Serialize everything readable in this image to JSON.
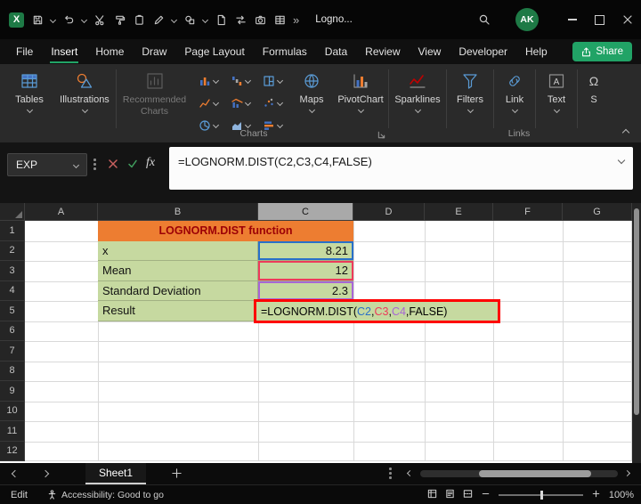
{
  "titlebar": {
    "title": "Logno...",
    "avatar": "AK"
  },
  "menu": {
    "items": [
      "File",
      "Insert",
      "Home",
      "Draw",
      "Page Layout",
      "Formulas",
      "Data",
      "Review",
      "View",
      "Developer",
      "Help"
    ],
    "active_index": 1,
    "share_label": "Share"
  },
  "icons": {
    "overflow": "»",
    "fx": "fx",
    "text_glyph": "A",
    "symbols_glyph": "Ω",
    "app_glyph": "X"
  },
  "ribbon": {
    "buttons": {
      "tables": "Tables",
      "illustrations": "Illustrations",
      "recommended_line1": "Recommended",
      "recommended_line2": "Charts",
      "maps": "Maps",
      "pivotchart": "PivotChart",
      "sparklines": "Sparklines",
      "filters": "Filters",
      "link": "Link",
      "text": "Text",
      "symbols": "S"
    },
    "group_labels": {
      "charts": "Charts",
      "links": "Links"
    }
  },
  "formula_bar": {
    "name_box": "EXP",
    "formula": "=LOGNORM.DIST(C2,C3,C4,FALSE)"
  },
  "grid": {
    "columns": [
      "A",
      "B",
      "C",
      "D",
      "E",
      "F",
      "G"
    ],
    "selected_column": "C",
    "row_count": 12,
    "title_cell": {
      "text": "LOGNORM.DIST function",
      "bg": "#ED7D31",
      "fg": "#9C0006"
    },
    "fill_green": "#C6D9A0",
    "data_rows": [
      {
        "label": "x",
        "value": "8.21",
        "ref_color": "#2970C8"
      },
      {
        "label": "Mean",
        "value": "12",
        "ref_color": "#ED3B5B"
      },
      {
        "label": "Standard Deviation",
        "value": "2.3",
        "ref_color": "#A766D6"
      },
      {
        "label": "Result",
        "value": "",
        "ref_color": ""
      }
    ],
    "formula_parts": [
      {
        "text": "=LOGNORM.DIST(",
        "color": "#000000"
      },
      {
        "text": "C2",
        "color": "#2970C8"
      },
      {
        "text": ",",
        "color": "#000000"
      },
      {
        "text": "C3",
        "color": "#ED3B5B"
      },
      {
        "text": ",",
        "color": "#000000"
      },
      {
        "text": "C4",
        "color": "#A766D6"
      },
      {
        "text": ",FALSE)",
        "color": "#000000"
      }
    ],
    "annotation_color": "#FF0000"
  },
  "sheet_bar": {
    "tab": "Sheet1"
  },
  "status_bar": {
    "mode": "Edit",
    "accessibility": "Accessibility: Good to go",
    "zoom": "100%"
  }
}
